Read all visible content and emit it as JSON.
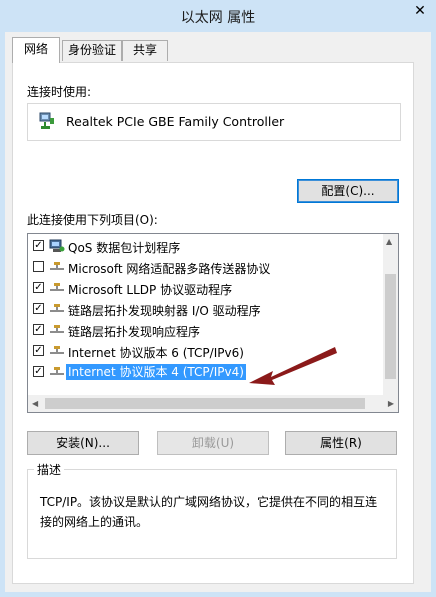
{
  "window": {
    "title": "以太网 属性",
    "close_glyph": "✕"
  },
  "tabs": [
    {
      "label": "网络",
      "active": true
    },
    {
      "label": "身份验证",
      "active": false
    },
    {
      "label": "共享",
      "active": false
    }
  ],
  "connect_using": {
    "label": "连接时使用:",
    "adapter_name": "Realtek PCIe GBE Family Controller"
  },
  "buttons": {
    "configure": "配置(C)...",
    "install": "安装(N)...",
    "uninstall": "卸载(U)",
    "properties": "属性(R)"
  },
  "items_label": "此连接使用下列项目(O):",
  "items": [
    {
      "label": "QoS 数据包计划程序",
      "checked": true,
      "icon": "qos-icon",
      "selected": false
    },
    {
      "label": "Microsoft 网络适配器多路传送器协议",
      "checked": false,
      "icon": "protocol-icon",
      "selected": false
    },
    {
      "label": "Microsoft LLDP 协议驱动程序",
      "checked": true,
      "icon": "protocol-icon",
      "selected": false
    },
    {
      "label": "链路层拓扑发现映射器 I/O 驱动程序",
      "checked": true,
      "icon": "protocol-icon",
      "selected": false
    },
    {
      "label": "链路层拓扑发现响应程序",
      "checked": true,
      "icon": "protocol-icon",
      "selected": false
    },
    {
      "label": "Internet 协议版本 6 (TCP/IPv6)",
      "checked": true,
      "icon": "protocol-icon",
      "selected": false
    },
    {
      "label": "Internet 协议版本 4 (TCP/IPv4)",
      "checked": true,
      "icon": "protocol-icon",
      "selected": true
    }
  ],
  "description": {
    "legend": "描述",
    "text": "TCP/IP。该协议是默认的广域网络协议，它提供在不同的相互连接的网络上的通讯。"
  },
  "colors": {
    "selection": "#3399ff",
    "annotation_arrow": "#8b1a1a",
    "titlebar": "#cde3f6"
  }
}
